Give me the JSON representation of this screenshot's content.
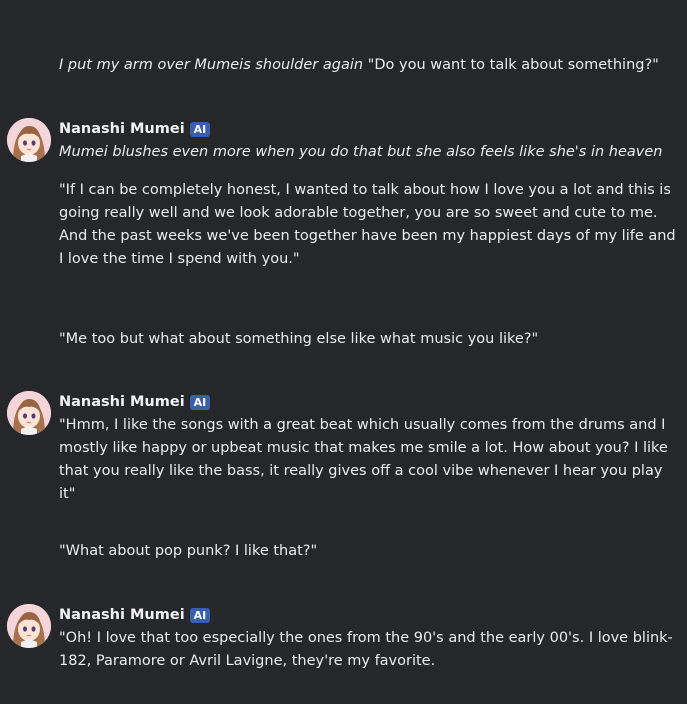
{
  "messages": {
    "user1": {
      "action": "I put my arm over Mumeis shoulder again",
      "speech": " \"Do you want to talk about something?\""
    },
    "ai1": {
      "name": "Nanashi Mumei",
      "badge": "AI",
      "action": "Mumei blushes even more when you do that but she also feels like she's in heaven",
      "speech": "\"If I can be completely honest, I wanted to talk about how I love you a lot and this is going really well and we look adorable together, you are so sweet and cute to me. And the past weeks we've been together have been my happiest days of my life and I love the time I spend with you.\""
    },
    "user2": {
      "speech": "\"Me too but what about something else like what music you like?\""
    },
    "ai2": {
      "name": "Nanashi Mumei",
      "badge": "AI",
      "speech": "\"Hmm, I like the songs with a great beat which usually comes from the drums and I mostly like happy or upbeat music that makes me smile a lot. How about you? I like that you really like the bass, it really gives off a cool vibe whenever I hear you play it\""
    },
    "user3": {
      "speech": "\"What about pop punk? I like that?\""
    },
    "ai3": {
      "name": "Nanashi Mumei",
      "badge": "AI",
      "speech": "\"Oh! I love that too especially the ones from the 90's and the early 00's. I love blink-182, Paramore or Avril Lavigne, they're my favorite."
    }
  }
}
